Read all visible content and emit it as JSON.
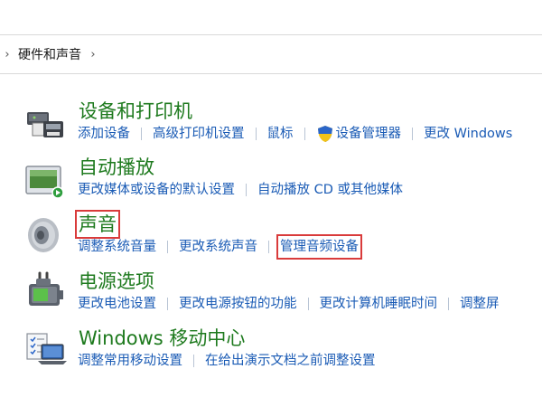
{
  "breadcrumb": {
    "items": [
      "硬件和声音"
    ]
  },
  "sections": [
    {
      "title": "设备和打印机",
      "icon": "printer-devices-icon",
      "links": [
        "添加设备",
        "高级打印机设置",
        "鼠标",
        "设备管理器",
        "更改 Windows"
      ]
    },
    {
      "title": "自动播放",
      "icon": "autoplay-icon",
      "links": [
        "更改媒体或设备的默认设置",
        "自动播放 CD 或其他媒体"
      ]
    },
    {
      "title": "声音",
      "icon": "speaker-icon",
      "links": [
        "调整系统音量",
        "更改系统声音",
        "管理音频设备"
      ]
    },
    {
      "title": "电源选项",
      "icon": "power-options-icon",
      "links": [
        "更改电池设置",
        "更改电源按钮的功能",
        "更改计算机睡眠时间",
        "调整屏"
      ]
    },
    {
      "title": "Windows 移动中心",
      "icon": "mobility-center-icon",
      "links": [
        "调整常用移动设置",
        "在给出演示文档之前调整设置"
      ]
    }
  ],
  "colors": {
    "title_green": "#1e7a1e",
    "link_blue": "#1a5bb5",
    "highlight_red": "#d93b3b"
  }
}
